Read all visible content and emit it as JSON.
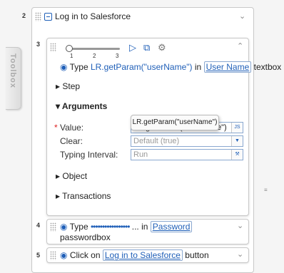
{
  "toolbox_label": "Toolbox",
  "step2": {
    "number": "2",
    "title": "Log in to Salesforce"
  },
  "step3": {
    "number": "3",
    "slider_ticks": [
      "1",
      "2",
      "3"
    ],
    "summary": {
      "prefix": "Type",
      "param": "LR.getParam(\"userName\")",
      "middle": "in",
      "target": "User Name",
      "suffix": "textbox"
    },
    "sections": {
      "step": "Step",
      "arguments": "Arguments",
      "object": "Object",
      "transactions": "Transactions"
    },
    "fields": {
      "required_mark": "*",
      "value_label": "Value:",
      "value_input": "LR.getParam(\"userName\")",
      "value_btn": "JS",
      "clear_label": "Clear:",
      "clear_input": "Default (true)",
      "interval_label": "Typing Interval:",
      "interval_input": "Run"
    },
    "tooltip": "LR.getParam(\"userName\")"
  },
  "step4": {
    "number": "4",
    "prefix": "Type",
    "masked": "•••••••••••••••••",
    "middle": "... in",
    "target": "Password",
    "line2": "passwordbox"
  },
  "step5": {
    "number": "5",
    "prefix": "Click on",
    "target": "Log in to Salesforce",
    "suffix": "button"
  },
  "colors": {
    "accent": "#1f5fb8",
    "link": "#1f5fb8",
    "border": "#c8c8c8"
  }
}
